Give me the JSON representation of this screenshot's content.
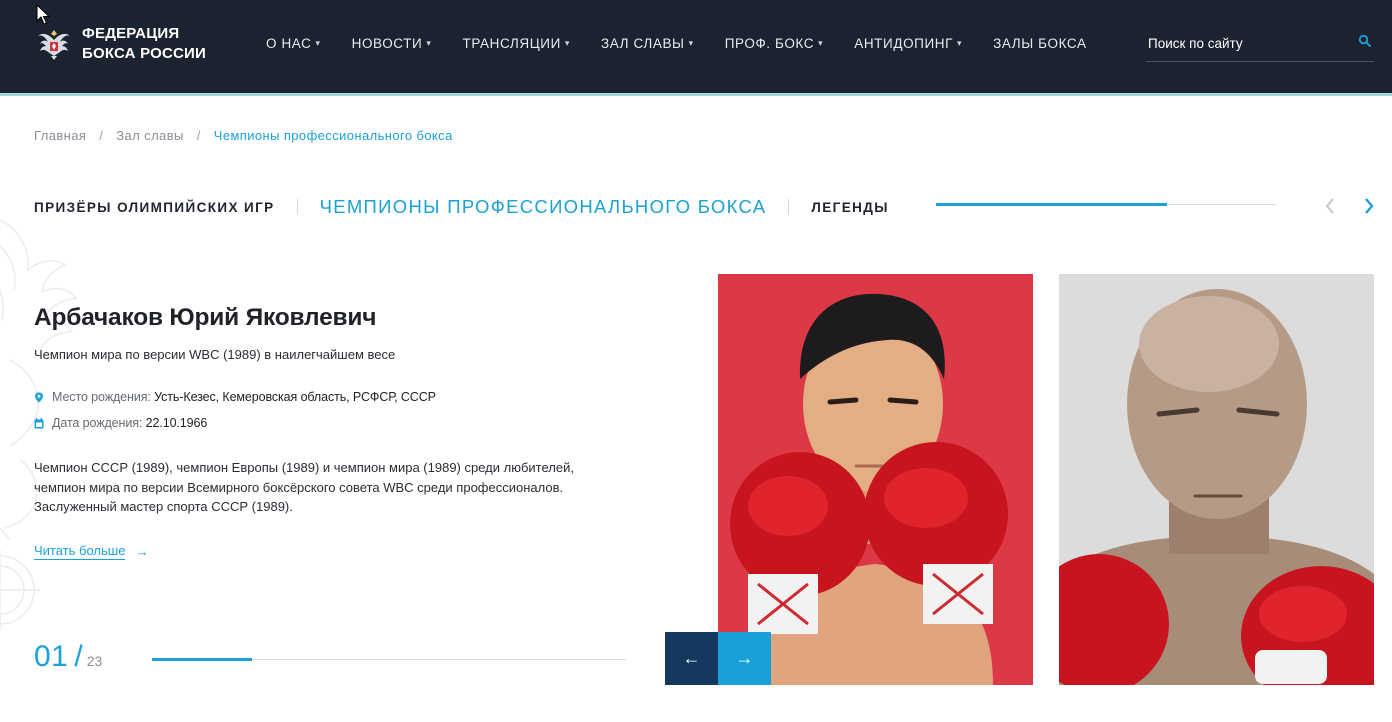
{
  "header": {
    "logo_line1": "ФЕДЕРАЦИЯ",
    "logo_line2": "БОКСА РОССИИ",
    "nav": [
      {
        "label": "О НАС",
        "has_caret": true
      },
      {
        "label": "НОВОСТИ",
        "has_caret": true
      },
      {
        "label": "ТРАНСЛЯЦИИ",
        "has_caret": true
      },
      {
        "label": "ЗАЛ СЛАВЫ",
        "has_caret": true
      },
      {
        "label": "ПРОФ. БОКС",
        "has_caret": true
      },
      {
        "label": "АНТИДОПИНГ",
        "has_caret": true
      },
      {
        "label": "ЗАЛЫ БОКСА",
        "has_caret": false
      }
    ],
    "search_placeholder": "Поиск по сайту",
    "caret_glyph": "▾",
    "colors": {
      "background": "#1b2230",
      "accent_line": "#9fd8d2",
      "search_icon": "#1aa2d8"
    }
  },
  "breadcrumb": {
    "items": [
      "Главная",
      "Зал славы"
    ],
    "separator": "/",
    "current": "Чемпионы профессионального бокса"
  },
  "tabs": {
    "items": [
      "ПРИЗЁРЫ ОЛИМПИЙСКИХ ИГР",
      "ЧЕМПИОНЫ ПРОФЕССИОНАЛЬНОГО БОКСА",
      "ЛЕГЕНДЫ"
    ],
    "active_index": 1,
    "progress_fraction": 0.68
  },
  "champion": {
    "name": "Арбачаков Юрий Яковлевич",
    "title": "Чемпион мира по версии WBC (1989) в наилегчайшем весе",
    "place_label": "Место рождения:",
    "place_value": "Усть-Кезес, Кемеровская область, РСФСР, СССР",
    "date_label": "Дата рождения:",
    "date_value": "22.10.1966",
    "description": "Чемпион СССР (1989), чемпион Европы (1989) и чемпион мира (1989) среди любителей, чемпион мира по версии Всемирного боксёрского совета WBC среди профессионалов. Заслуженный мастер спорта СССР (1989).",
    "read_more": "Читать больше",
    "read_more_arrow": "→"
  },
  "pager": {
    "current": "01",
    "slash": "/",
    "total": "23",
    "progress_fraction": 0.21
  },
  "slider": {
    "prev_arrow": "←",
    "next_arrow": "→"
  },
  "colors": {
    "accent": "#1aa2d8",
    "dark_button": "#133a5e",
    "text": "#1f2228"
  }
}
